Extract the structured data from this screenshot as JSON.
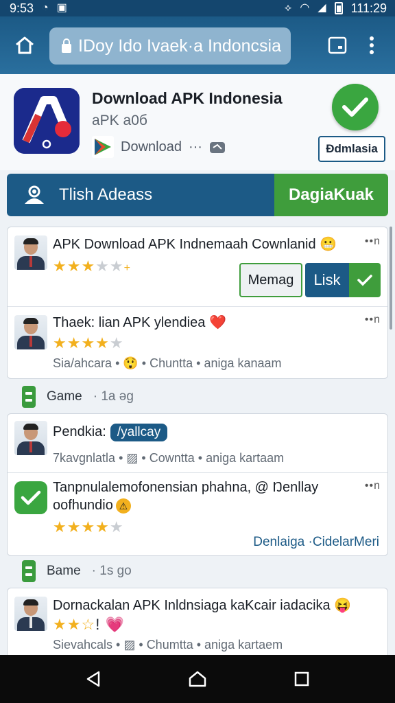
{
  "status_bar": {
    "time": "9:53",
    "clock_right": "111:29"
  },
  "address_bar": {
    "url_text": "IDoy Ido Ivaek·a Indoncsia"
  },
  "app_header": {
    "title": "Download APK Indonesia",
    "subtitle": "aPK a0б",
    "download_label": "Download",
    "more": "···",
    "button_label": "Đdmlasia"
  },
  "action_bar": {
    "left_label": "Tlish Adeass",
    "right_label": "DagiaKuak"
  },
  "items_card1": [
    {
      "title": "APK Download APK Indnemaah Cownlanid",
      "emoji": "😬",
      "stars": "★★★",
      "stars_off": "★★",
      "plus": "+",
      "more": "••n",
      "btn_secondary": "Memag",
      "btn_primary": "Lisk"
    },
    {
      "title": "Thaek: lian APK ylendiea",
      "emoji": "❤️",
      "stars": "★★★★",
      "stars_off": "★",
      "meta_a": "Sia/ahcara",
      "meta_emoji": "😲",
      "meta_b": "Chuntta",
      "meta_c": "aniga kanaam",
      "more": "••n"
    }
  ],
  "section1": {
    "label": "Game",
    "time": "1a ǝg"
  },
  "items_card2": [
    {
      "title": "Pendkia:",
      "tag": "/yallcay",
      "meta_a": "7kavgnlatla",
      "meta_b": "Cowntta",
      "meta_c": "aniga kartaam"
    },
    {
      "title": "Tanpnulalemofonensian phahna, @ Ŋenllay",
      "title2": "oofhundio",
      "emoji2": "⚠",
      "stars": "★★★★",
      "stars_off": "★",
      "more": "••n",
      "links": "Denlaiga ·CidelarMeri"
    }
  ],
  "section2": {
    "label": "Bame",
    "time": "1s go"
  },
  "items_card3": [
    {
      "title": "Dornackalan APK Inldnsiaga kaKcair iadacika",
      "emoji": "😝",
      "stars": "★★",
      "stars_off": "☆",
      "exclaim": "!",
      "heart": "💗",
      "meta_a": "Sievahcals",
      "meta_b": "Chumtta",
      "meta_c": "aniga kartaem"
    }
  ],
  "colors": {
    "primary": "#1c5a86",
    "accent_green": "#3f9d3c",
    "star": "#f2b01e"
  }
}
